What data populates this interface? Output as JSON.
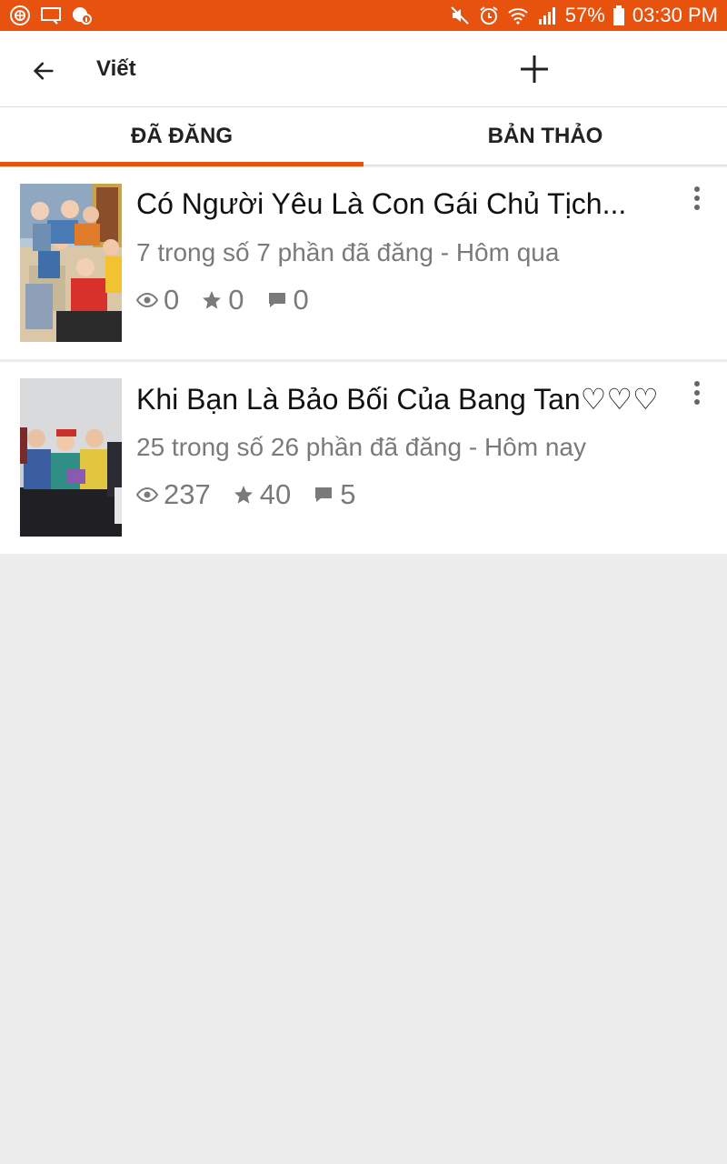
{
  "status_bar": {
    "battery": "57%",
    "time": "03:30 PM",
    "icons": [
      "app-notification-icon",
      "cast-icon",
      "shield-icon",
      "mute-icon",
      "alarm-icon",
      "wifi-icon",
      "signal-icon",
      "battery-icon"
    ]
  },
  "app_bar": {
    "title": "Viết",
    "back_icon": "arrow-left-icon",
    "add_icon": "plus-icon"
  },
  "tabs": [
    {
      "label": "ĐÃ ĐĂNG",
      "active": true
    },
    {
      "label": "BẢN THẢO",
      "active": false
    }
  ],
  "stories": [
    {
      "title": "Có Người Yêu Là Con Gái Chủ Tịch...",
      "meta": "7 trong số 7 phần đã đăng - Hôm qua",
      "views": "0",
      "votes": "0",
      "comments": "0"
    },
    {
      "title": "Khi Bạn Là Bảo Bối Của Bang Tan♡♡♡",
      "meta": "25 trong số 26 phần đã đăng - Hôm nay",
      "views": "237",
      "votes": "40",
      "comments": "5"
    }
  ],
  "colors": {
    "accent": "#e8520f",
    "background": "#ececec",
    "meta_text": "#7a7a7a"
  }
}
